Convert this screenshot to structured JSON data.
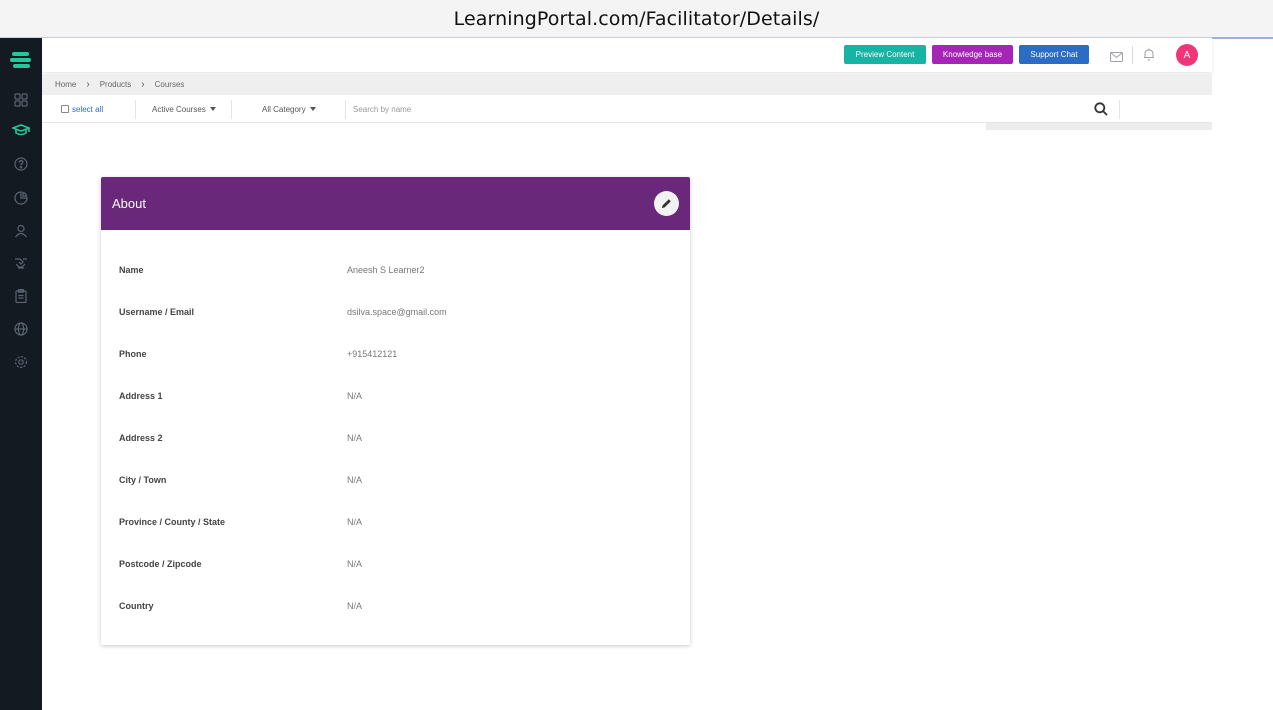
{
  "browser": {
    "url": "LearningPortal.com/Facilitator/Details/"
  },
  "sidebar": {
    "icons": [
      "logo-icon",
      "grid-icon",
      "graduation-cap-icon",
      "help-icon",
      "chart-icon",
      "user-icon",
      "handshake-icon",
      "clipboard-icon",
      "globe-icon",
      "settings-icon"
    ],
    "accent_color": "#20c997"
  },
  "topbar": {
    "preview_label": "Preview Content",
    "knowledge_label": "Knowledge base",
    "support_label": "Support Chat",
    "avatar_letter": "A"
  },
  "breadcrumb": {
    "items": [
      "Home",
      "Products",
      "Courses"
    ]
  },
  "filters": {
    "select_all": "select all",
    "active_courses": "Active Courses",
    "category": "All Category",
    "search_placeholder": "Search by name"
  },
  "about": {
    "title": "About",
    "fields": [
      {
        "label": "Name",
        "value": "Aneesh S Learner2"
      },
      {
        "label": "Username / Email",
        "value": "dsilva.space@gmail.com"
      },
      {
        "label": "Phone",
        "value": "+915412121"
      },
      {
        "label": "Address 1",
        "value": "N/A"
      },
      {
        "label": "Address 2",
        "value": "N/A"
      },
      {
        "label": "City / Town",
        "value": "N/A"
      },
      {
        "label": "Province / County / State",
        "value": "N/A"
      },
      {
        "label": "Postcode / Zipcode",
        "value": "N/A"
      },
      {
        "label": "Country",
        "value": "N/A"
      }
    ]
  },
  "colors": {
    "header_purple": "#692879",
    "preview_teal": "#17b3a3",
    "knowledge_purple": "#a525b7",
    "support_blue": "#2b6cc4",
    "avatar_pink": "#f0357a"
  }
}
